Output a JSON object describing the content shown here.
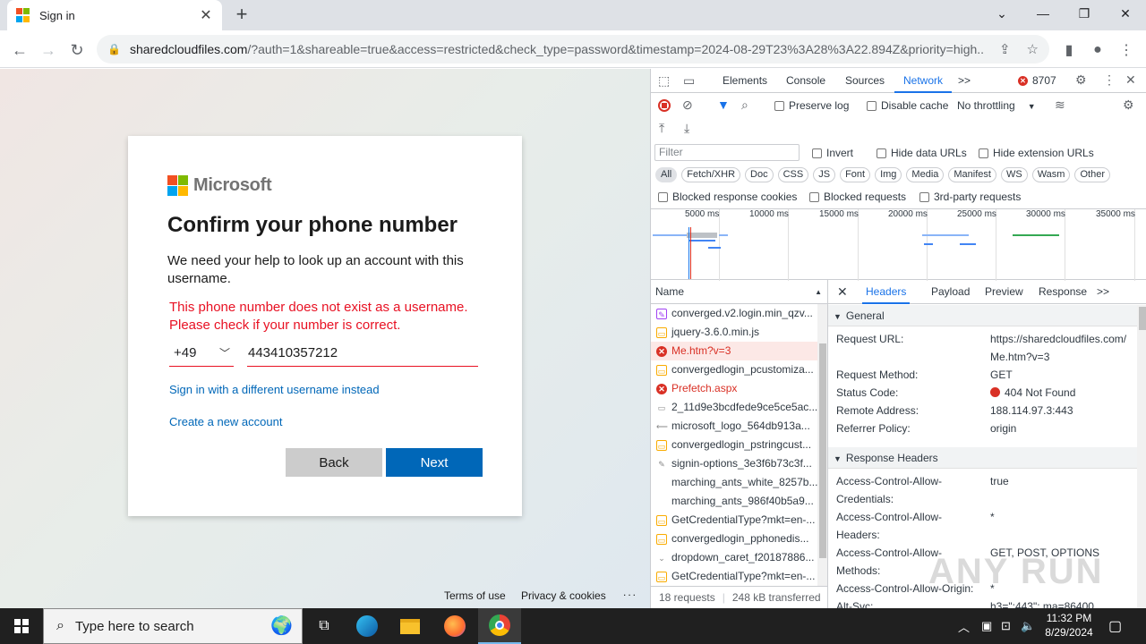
{
  "browser": {
    "tab_title": "Sign in",
    "url_host": "sharedcloudfiles.com",
    "url_rest": "/?auth=1&shareable=true&access=restricted&check_type=password&timestamp=2024-08-29T23%3A28%3A22.894Z&priority=high..."
  },
  "signin": {
    "brand": "Microsoft",
    "heading": "Confirm your phone number",
    "description": "We need your help to look up an account with this username.",
    "error": "This phone number does not exist as a username. Please check if your number is correct.",
    "country_code": "+49",
    "phone_value": "443410357212",
    "link_different": "Sign in with a different username instead",
    "link_create": "Create a new account",
    "back_label": "Back",
    "next_label": "Next",
    "footer_terms": "Terms of use",
    "footer_privacy": "Privacy & cookies",
    "footer_more": "..."
  },
  "devtools": {
    "tabs": [
      "Elements",
      "Console",
      "Sources",
      "Network"
    ],
    "active_tab": "Network",
    "more": ">>",
    "error_count": "8707",
    "preserve_log": "Preserve log",
    "disable_cache": "Disable cache",
    "throttling": "No throttling",
    "filter_placeholder": "Filter",
    "invert": "Invert",
    "hide_data_urls": "Hide data URLs",
    "hide_extension_urls": "Hide extension URLs",
    "type_chips": [
      "All",
      "Fetch/XHR",
      "Doc",
      "CSS",
      "JS",
      "Font",
      "Img",
      "Media",
      "Manifest",
      "WS",
      "Wasm",
      "Other"
    ],
    "blocked_cookies": "Blocked response cookies",
    "blocked_requests": "Blocked requests",
    "third_party": "3rd-party requests",
    "timeline_ticks": [
      "5000 ms",
      "10000 ms",
      "15000 ms",
      "20000 ms",
      "25000 ms",
      "30000 ms",
      "35000 ms"
    ],
    "name_header": "Name",
    "requests": [
      {
        "name": "converged.v2.login.min_qzv...",
        "type": "css"
      },
      {
        "name": "jquery-3.6.0.min.js",
        "type": "js"
      },
      {
        "name": "Me.htm?v=3",
        "type": "err"
      },
      {
        "name": "convergedlogin_pcustomiza...",
        "type": "js"
      },
      {
        "name": "Prefetch.aspx",
        "type": "err"
      },
      {
        "name": "2_11d9e3bcdfede9ce5ce5ac...",
        "type": "img"
      },
      {
        "name": "microsoft_logo_564db913a...",
        "type": "img"
      },
      {
        "name": "convergedlogin_pstringcust...",
        "type": "js"
      },
      {
        "name": "signin-options_3e3f6b73c3f...",
        "type": "img"
      },
      {
        "name": "marching_ants_white_8257b...",
        "type": "img"
      },
      {
        "name": "marching_ants_986f40b5a9...",
        "type": "img"
      },
      {
        "name": "GetCredentialType?mkt=en-...",
        "type": "js"
      },
      {
        "name": "convergedlogin_pphonedis...",
        "type": "js"
      },
      {
        "name": "dropdown_caret_f20187886...",
        "type": "img"
      },
      {
        "name": "GetCredentialType?mkt=en-...",
        "type": "js"
      }
    ],
    "footer_requests": "18 requests",
    "footer_transferred": "248 kB transferred",
    "detail_tabs": [
      "Headers",
      "Payload",
      "Preview",
      "Response"
    ],
    "general_label": "General",
    "general": [
      {
        "k": "Request URL:",
        "v": "https://sharedcloudfiles.com/Me.htm?v=3"
      },
      {
        "k": "Request Method:",
        "v": "GET"
      },
      {
        "k": "Status Code:",
        "v": "404 Not Found"
      },
      {
        "k": "Remote Address:",
        "v": "188.114.97.3:443"
      },
      {
        "k": "Referrer Policy:",
        "v": "origin"
      }
    ],
    "response_label": "Response Headers",
    "response": [
      {
        "k": "Access-Control-Allow-Credentials:",
        "v": "true"
      },
      {
        "k": "Access-Control-Allow-Headers:",
        "v": "*"
      },
      {
        "k": "Access-Control-Allow-Methods:",
        "v": "GET, POST, OPTIONS"
      },
      {
        "k": "Access-Control-Allow-Origin:",
        "v": "*"
      },
      {
        "k": "Alt-Svc:",
        "v": "h3=\":443\"; ma=86400"
      }
    ]
  },
  "watermark": "ANY RUN",
  "taskbar": {
    "search_placeholder": "Type here to search",
    "time": "11:32 PM",
    "date": "8/29/2024"
  },
  "colors": {
    "ms_red": "#f25022",
    "ms_green": "#7fba00",
    "ms_blue": "#00a4ef",
    "ms_yellow": "#ffb900",
    "accent": "#0067b8",
    "error": "#e81123"
  }
}
